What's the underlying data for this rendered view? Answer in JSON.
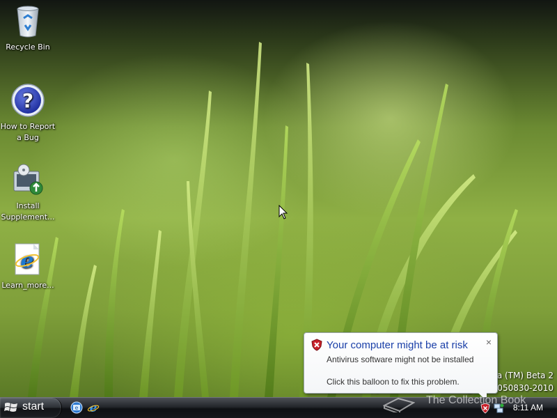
{
  "desktop": {
    "icons": [
      {
        "label": "Recycle Bin",
        "icon": "recycle-bin-icon"
      },
      {
        "label": "How to Report a Bug",
        "icon": "help-question-icon"
      },
      {
        "label": "Install Supplement...",
        "icon": "install-supplement-icon"
      },
      {
        "label": "Learn_more...",
        "icon": "internet-explorer-icon"
      }
    ],
    "watermark": {
      "line1": "Windows Vista (TM) Beta 2",
      "line2": "Evaluation copy. Build 5231.winmain_idx02.050830-2010"
    }
  },
  "notification": {
    "title": "Your computer might be at risk",
    "line1": "Antivirus software might not be installed",
    "line2": "Click this balloon to fix this problem.",
    "close_glyph": "×",
    "icon": "security-shield-icon",
    "title_color": "#1a3fa8"
  },
  "taskbar": {
    "start_label": "start",
    "quick_launch": [
      {
        "icon": "show-desktop-icon"
      },
      {
        "icon": "internet-explorer-icon"
      }
    ],
    "tray": {
      "icons": [
        "security-shield-icon",
        "network-icon"
      ],
      "clock": "8:11 AM"
    }
  },
  "overlay": {
    "watermark_text": "The Collection Book"
  }
}
